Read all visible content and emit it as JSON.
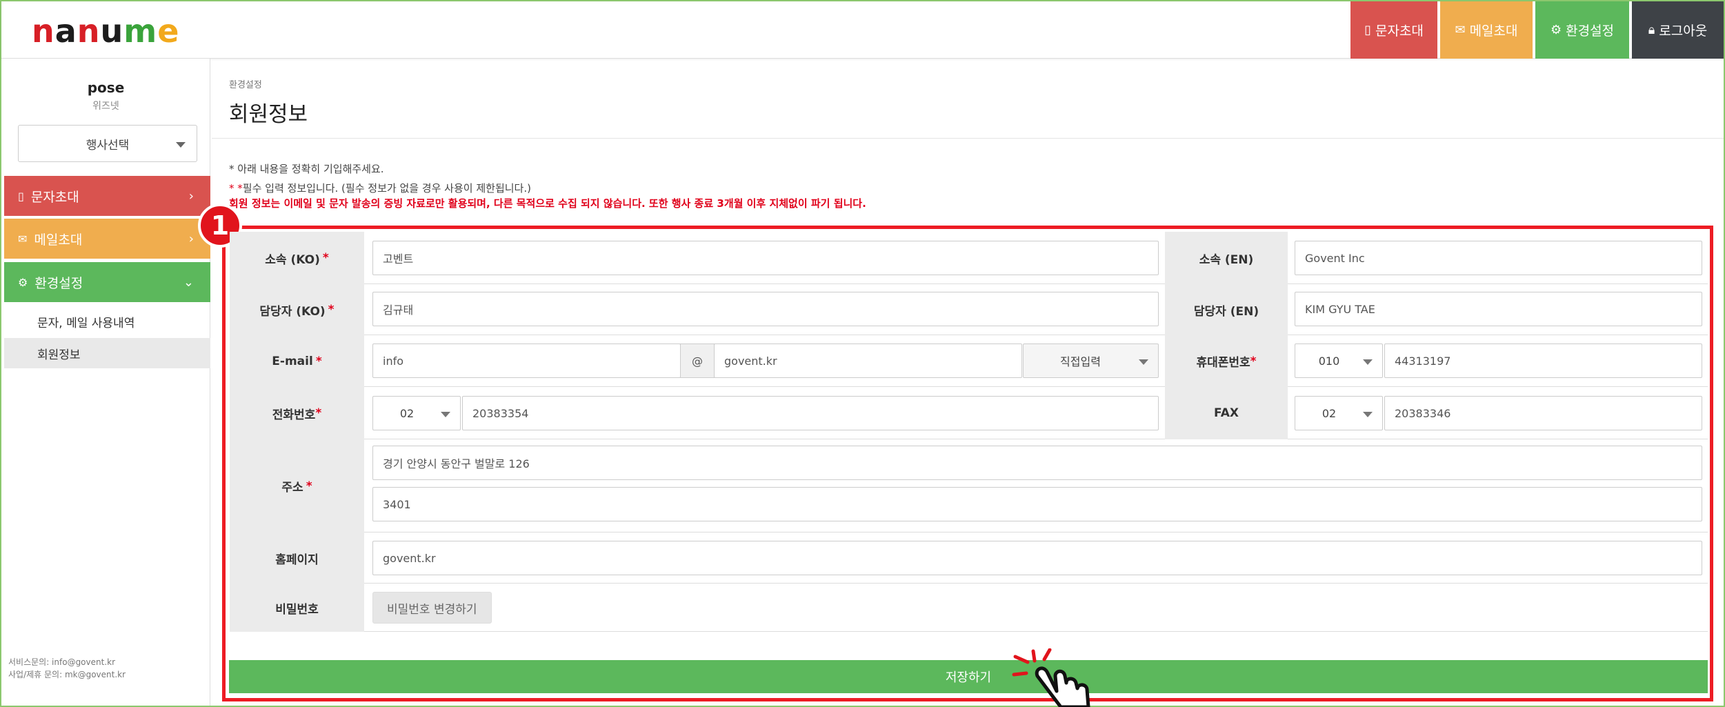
{
  "header": {
    "logo": {
      "n1": "n",
      "a1": "a",
      "n2": "n",
      "u": "u",
      "m": "m",
      "e": "e"
    },
    "nav": [
      {
        "label": "문자초대",
        "icon": "mobile-icon",
        "color": "#d9534f"
      },
      {
        "label": "메일초대",
        "icon": "envelope-icon",
        "color": "#f0ad4e"
      },
      {
        "label": "환경설정",
        "icon": "gear-icon",
        "color": "#5cb85c"
      },
      {
        "label": "로그아웃",
        "icon": "lock-icon",
        "color": "#3e4247"
      }
    ]
  },
  "sidebar": {
    "user_name": "pose",
    "user_org": "위즈넷",
    "event_select": "행사선택",
    "menu": [
      {
        "label": "문자초대",
        "icon": "mobile-icon"
      },
      {
        "label": "메일초대",
        "icon": "envelope-icon"
      },
      {
        "label": "환경설정",
        "icon": "gear-icon"
      }
    ],
    "submenu": [
      {
        "label": "문자, 메일 사용내역"
      },
      {
        "label": "회원정보"
      }
    ],
    "footer": {
      "service": "서비스문의: info@govent.kr",
      "business": "사업/제휴 문의: mk@govent.kr"
    }
  },
  "main": {
    "breadcrumb": "환경설정",
    "title": "회원정보",
    "notes": {
      "line1": "* 아래 내용을 정확히 기입해주세요.",
      "line2_mark": "* *",
      "line2": "필수 입력 정보입니다. (필수 정보가 없을 경우 사용이 제한됩니다.)",
      "line3": "회원 정보는 이메일 및 문자 발송의 증빙 자료로만 활용되며, 다른 목적으로 수집 되지 않습니다. 또한 행사 종료 3개월 이후 지체없이 파기 됩니다."
    },
    "badge": "1",
    "form": {
      "org_ko": {
        "label": "소속 (KO)",
        "value": "고벤트"
      },
      "org_en": {
        "label": "소속 (EN)",
        "value": "Govent Inc"
      },
      "manager_ko": {
        "label": "담당자 (KO)",
        "value": "김규태"
      },
      "manager_en": {
        "label": "담당자 (EN)",
        "value": "KIM GYU TAE"
      },
      "email": {
        "label": "E-mail",
        "id": "info",
        "at": "@",
        "domain": "govent.kr",
        "domain_select": "직접입력"
      },
      "mobile": {
        "label": "휴대폰번호",
        "prefix": "010",
        "number": "44313197"
      },
      "phone": {
        "label": "전화번호",
        "prefix": "02",
        "number": "20383354"
      },
      "fax": {
        "label": "FAX",
        "prefix": "02",
        "number": "20383346"
      },
      "address": {
        "label": "주소",
        "line1": "경기 안양시 동안구 벌말로 126",
        "line2": "3401"
      },
      "homepage": {
        "label": "홈페이지",
        "value": "govent.kr"
      },
      "password": {
        "label": "비밀번호",
        "button": "비밀번호 변경하기"
      },
      "required_mark": "*"
    },
    "save_button": "저장하기"
  },
  "colors": {
    "accent_red": "#ed1c24",
    "green": "#5cb85c",
    "orange": "#f0ad4e",
    "red": "#d9534f",
    "dark": "#3e4247"
  }
}
